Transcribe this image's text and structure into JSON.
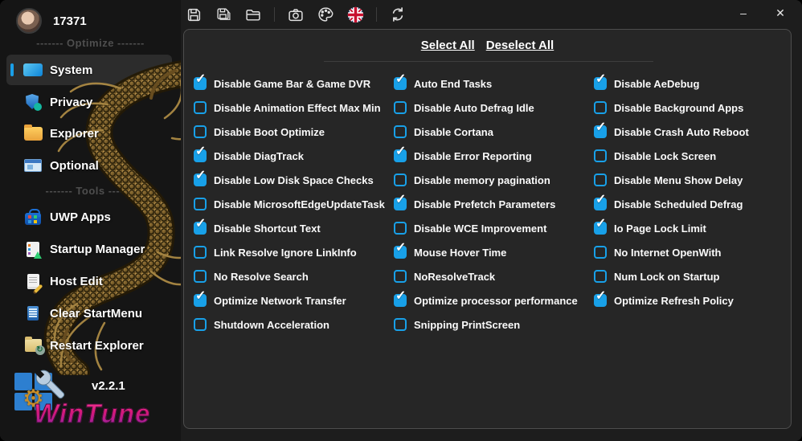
{
  "window": {
    "minimize_glyph": "–",
    "close_glyph": "✕"
  },
  "colors": {
    "accent_blue": "#18a0e8",
    "brand_pink": "#e91e63",
    "brand_purple": "#8e24aa",
    "dragon_gold": "#a8803d",
    "panel_bg": "#262626",
    "sidebar_bg": "#151515"
  },
  "icons": {
    "check_glyph": "✓",
    "restart_badge_glyph": "↻",
    "toolbar": [
      "save-icon",
      "save-all-icon",
      "open-folder-icon",
      "camera-icon",
      "theme-palette-icon",
      "language-uk-flag-icon",
      "refresh-icon"
    ]
  },
  "sidebar": {
    "profile": {
      "name": "17371"
    },
    "sections": [
      {
        "label": "------- Optimize -------",
        "items": [
          {
            "label": "System",
            "active": true
          },
          {
            "label": "Privacy",
            "active": false
          },
          {
            "label": "Explorer",
            "active": false
          },
          {
            "label": "Optional",
            "active": false
          }
        ]
      },
      {
        "label": "------- Tools -------",
        "items": [
          {
            "label": "UWP Apps",
            "active": false
          },
          {
            "label": "Startup Manager",
            "active": false
          },
          {
            "label": "Host Edit",
            "active": false
          },
          {
            "label": "Clear StartMenu",
            "active": false
          },
          {
            "label": "Restart Explorer",
            "active": false
          }
        ]
      }
    ],
    "version": "v2.2.1",
    "brand": "WinTune"
  },
  "main": {
    "select_all_label": "Select All",
    "deselect_all_label": "Deselect All",
    "columns": [
      {
        "items": [
          {
            "label": "Disable Game Bar & Game DVR",
            "checked": true
          },
          {
            "label": "Disable Animation Effect Max Min",
            "checked": false
          },
          {
            "label": "Disable Boot Optimize",
            "checked": false
          },
          {
            "label": "Disable DiagTrack",
            "checked": true
          },
          {
            "label": "Disable Low Disk Space Checks",
            "checked": true
          },
          {
            "label": "Disable MicrosoftEdgeUpdateTask",
            "checked": false
          },
          {
            "label": "Disable Shortcut Text",
            "checked": true
          },
          {
            "label": "Link Resolve Ignore LinkInfo",
            "checked": false
          },
          {
            "label": "No Resolve Search",
            "checked": false
          },
          {
            "label": "Optimize Network Transfer",
            "checked": true
          },
          {
            "label": "Shutdown Acceleration",
            "checked": false
          }
        ]
      },
      {
        "items": [
          {
            "label": "Auto End Tasks",
            "checked": true
          },
          {
            "label": "Disable Auto Defrag Idle",
            "checked": false
          },
          {
            "label": "Disable Cortana",
            "checked": false
          },
          {
            "label": "Disable Error Reporting",
            "checked": true
          },
          {
            "label": "Disable memory pagination",
            "checked": false
          },
          {
            "label": "Disable Prefetch Parameters",
            "checked": true
          },
          {
            "label": "Disable WCE Improvement",
            "checked": false
          },
          {
            "label": "Mouse Hover Time",
            "checked": true
          },
          {
            "label": "NoResolveTrack",
            "checked": false
          },
          {
            "label": "Optimize processor performance",
            "checked": true
          },
          {
            "label": "Snipping PrintScreen",
            "checked": false
          }
        ]
      },
      {
        "items": [
          {
            "label": "Disable AeDebug",
            "checked": true
          },
          {
            "label": "Disable Background Apps",
            "checked": false
          },
          {
            "label": "Disable Crash Auto Reboot",
            "checked": true
          },
          {
            "label": "Disable Lock Screen",
            "checked": false
          },
          {
            "label": "Disable Menu Show Delay",
            "checked": false
          },
          {
            "label": "Disable Scheduled Defrag",
            "checked": true
          },
          {
            "label": "Io Page Lock Limit",
            "checked": true
          },
          {
            "label": "No Internet OpenWith",
            "checked": false
          },
          {
            "label": "Num Lock on Startup",
            "checked": false
          },
          {
            "label": "Optimize Refresh Policy",
            "checked": true
          }
        ]
      }
    ]
  }
}
